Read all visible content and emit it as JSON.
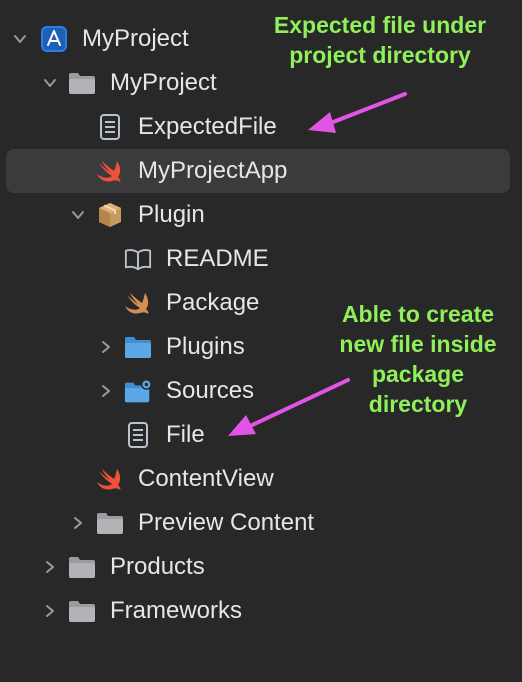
{
  "navigator": {
    "rows": [
      {
        "label": "MyProject",
        "icon": "xcode-project-icon",
        "disclosure": "expanded"
      },
      {
        "label": "MyProject",
        "icon": "folder-icon",
        "disclosure": "expanded"
      },
      {
        "label": "ExpectedFile",
        "icon": "document-icon",
        "disclosure": "none"
      },
      {
        "label": "MyProjectApp",
        "icon": "swift-icon",
        "disclosure": "none",
        "selected": true
      },
      {
        "label": "Plugin",
        "icon": "package-icon",
        "disclosure": "expanded"
      },
      {
        "label": "README",
        "icon": "book-icon",
        "disclosure": "none"
      },
      {
        "label": "Package",
        "icon": "swift-icon",
        "disclosure": "none"
      },
      {
        "label": "Plugins",
        "icon": "blue-folder-icon",
        "disclosure": "collapsed"
      },
      {
        "label": "Sources",
        "icon": "blue-folder-gear-icon",
        "disclosure": "collapsed"
      },
      {
        "label": "File",
        "icon": "document-icon",
        "disclosure": "none"
      },
      {
        "label": "ContentView",
        "icon": "swift-icon",
        "disclosure": "none"
      },
      {
        "label": "Preview Content",
        "icon": "folder-icon",
        "disclosure": "collapsed"
      },
      {
        "label": "Products",
        "icon": "folder-icon",
        "disclosure": "collapsed"
      },
      {
        "label": "Frameworks",
        "icon": "folder-icon",
        "disclosure": "collapsed"
      }
    ]
  },
  "annotations": {
    "expected_line1": "Expected file under",
    "expected_line2": "project directory",
    "able_line1": "Able to create",
    "able_line2": "new file inside",
    "able_line3": "package",
    "able_line4": "directory"
  },
  "colors": {
    "annotation_text": "#8ff05a",
    "arrow": "#e254e6",
    "selection": "#3b3b3d",
    "swift": "#f05138",
    "blue_folder": "#5aa9e6"
  }
}
